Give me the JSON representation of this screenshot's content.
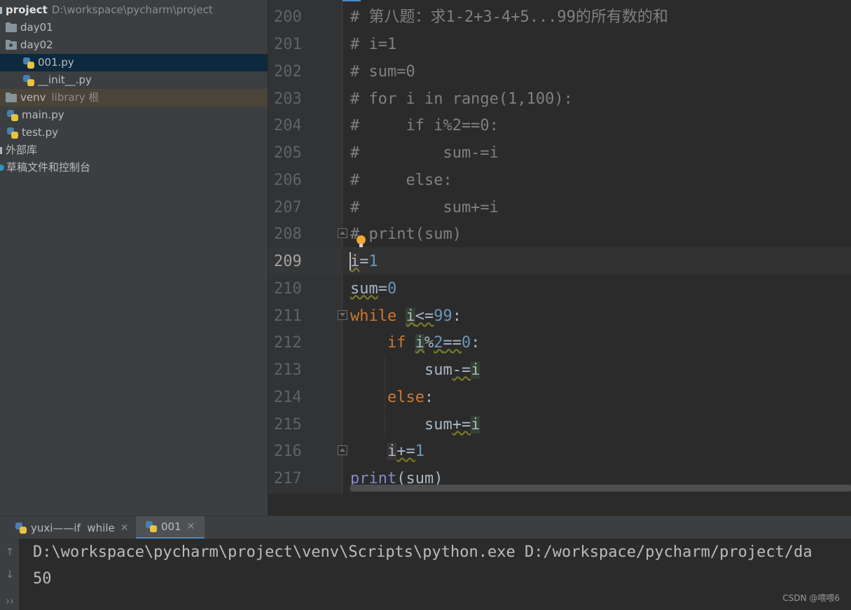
{
  "project_tree": {
    "project_name": "project",
    "project_path": "D:\\workspace\\pycharm\\project",
    "items": [
      {
        "label": "day01",
        "icon": "folder-icon"
      },
      {
        "label": "day02",
        "icon": "package-folder-icon"
      },
      {
        "label": "001.py",
        "icon": "python-file-icon",
        "selected": true
      },
      {
        "label": "__init__.py",
        "icon": "python-file-icon"
      },
      {
        "label": "venv",
        "tag": "library 根",
        "icon": "folder-icon"
      },
      {
        "label": "main.py",
        "icon": "python-file-icon"
      },
      {
        "label": "test.py",
        "icon": "python-file-icon"
      },
      {
        "label": "外部库",
        "icon": "library-icon"
      },
      {
        "label": "草稿文件和控制台",
        "icon": "scratches-icon"
      }
    ]
  },
  "editor": {
    "line_numbers": [
      "200",
      "201",
      "202",
      "203",
      "204",
      "205",
      "206",
      "207",
      "208",
      "209",
      "210",
      "211",
      "212",
      "213",
      "214",
      "215",
      "216",
      "217"
    ],
    "current_line": "209",
    "code": {
      "l200": "# 第八题：求1-2+3-4+5...99的所有数的和",
      "l201": "# i=1",
      "l202": "# sum=0",
      "l203": "# for i in range(1,100):",
      "l204": "#     if i%2==0:",
      "l205": "#         sum-=i",
      "l206": "#     else:",
      "l207": "#         sum+=i",
      "l208": "# print(sum)",
      "l209": {
        "a": "i",
        "b": "=",
        "c": "1"
      },
      "l210": {
        "a": "sum",
        "b": "=",
        "c": "0"
      },
      "l211": {
        "kw": "while",
        "sp": " ",
        "a": "i",
        "b": "<=",
        "c": "99",
        "d": ":"
      },
      "l212": {
        "indent": "    ",
        "kw": "if",
        "sp": " ",
        "a": "i",
        "b": "%",
        "c": "2",
        "d": "==",
        "e": "0",
        "f": ":"
      },
      "l213": {
        "indent": "        ",
        "a": "sum",
        "b": "-=",
        "c": "i"
      },
      "l214": {
        "indent": "    ",
        "kw": "else",
        "d": ":"
      },
      "l215": {
        "indent": "        ",
        "a": "sum",
        "b": "+=",
        "c": "i"
      },
      "l216": {
        "indent": "    ",
        "a": "i",
        "b": "+=",
        "c": "1"
      },
      "l217": {
        "fn": "print",
        "a": "(",
        "b": "sum",
        "c": ")"
      }
    }
  },
  "run_panel": {
    "tabs": [
      {
        "label": "yuxi——if  while"
      },
      {
        "label": "001",
        "active": true
      }
    ],
    "output": [
      "D:\\workspace\\pycharm\\project\\venv\\Scripts\\python.exe D:/workspace/pycharm/project/da",
      "50"
    ],
    "toolbar": {
      "up": "↑",
      "down": "↓",
      "more": "››"
    }
  },
  "watermark": "CSDN @喂喂6",
  "colors": {
    "keyword": "#cc7832",
    "number": "#6897bb",
    "comment": "#808080",
    "builtin": "#8888c6",
    "accent": "#4a88c7"
  }
}
